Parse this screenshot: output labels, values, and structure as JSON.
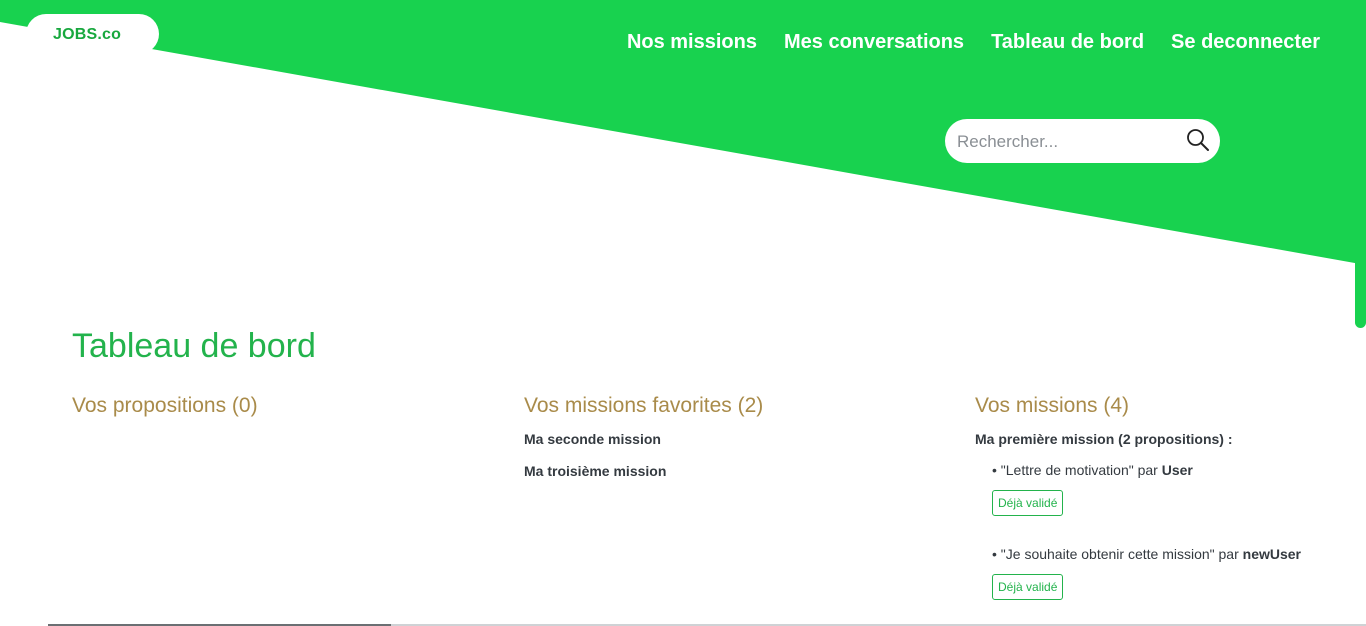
{
  "colors": {
    "brand_green": "#18d24f",
    "title_green": "#23b34c",
    "section_gold": "#a98b4a",
    "text_dark": "#343a40"
  },
  "header": {
    "logo": "JOBS.co",
    "nav": [
      {
        "label": "Nos missions"
      },
      {
        "label": "Mes conversations"
      },
      {
        "label": "Tableau de bord"
      },
      {
        "label": "Se deconnecter"
      }
    ],
    "search": {
      "placeholder": "Rechercher...",
      "icon": "search-icon"
    }
  },
  "main": {
    "title": "Tableau de bord",
    "propositions": {
      "heading": "Vos propositions (0)"
    },
    "favorites": {
      "heading": "Vos missions favorites (2)",
      "items": [
        {
          "label": "Ma seconde mission"
        },
        {
          "label": "Ma troisième mission"
        }
      ]
    },
    "missions": {
      "heading": "Vos missions (4)",
      "items": [
        {
          "title": "Ma première mission (2 propositions) :",
          "proposals": [
            {
              "bullet": "• ",
              "text": "\"Lettre de motivation\" par ",
              "user": "User",
              "badge": "Déjà validé"
            },
            {
              "bullet": "• ",
              "text": "\"Je souhaite obtenir cette mission\" par ",
              "user": "newUser",
              "badge": "Déjà validé"
            }
          ]
        }
      ]
    }
  }
}
